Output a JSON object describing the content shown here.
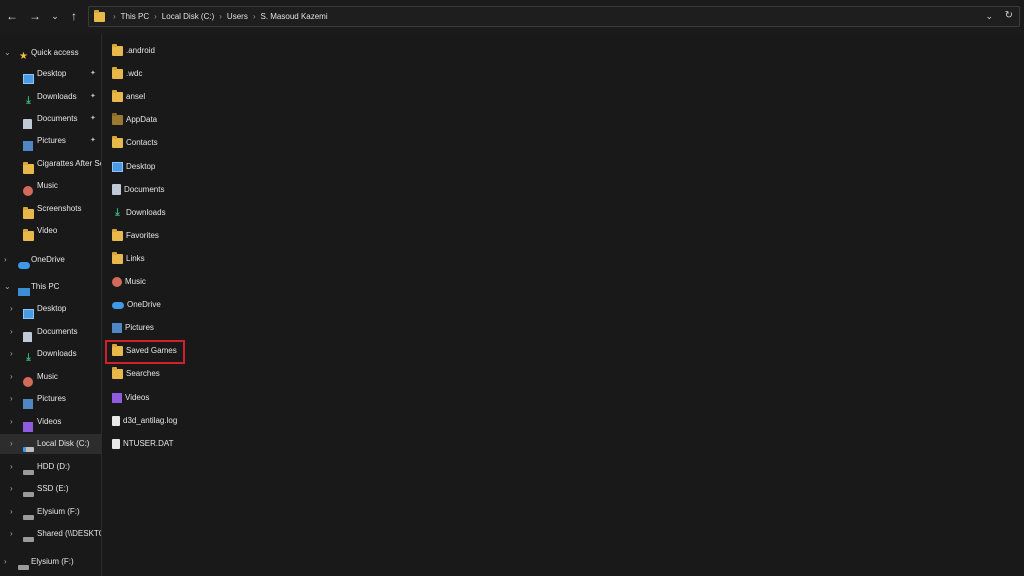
{
  "toolbar": {
    "back": "←",
    "forward": "→",
    "recent": "⌄",
    "up": "↑"
  },
  "address": {
    "crumbs": [
      "This PC",
      "Local Disk (C:)",
      "Users",
      "S. Masoud Kazemi"
    ],
    "separator": "›",
    "dropdown": "⌄",
    "refresh": "↻"
  },
  "sidebar": {
    "items": [
      {
        "label": "Quick access",
        "icon": "star-icon",
        "chevron": "⌄"
      },
      {
        "label": "Desktop",
        "icon": "desktop-icon",
        "pin": "📌"
      },
      {
        "label": "Downloads",
        "icon": "downloads-icon",
        "pin": "📌"
      },
      {
        "label": "Documents",
        "icon": "documents-icon",
        "pin": "📌"
      },
      {
        "label": "Pictures",
        "icon": "pictures-icon",
        "pin": "📌"
      },
      {
        "label": "Cigarattes After Se",
        "icon": "folder-icon"
      },
      {
        "label": "Music",
        "icon": "music-icon"
      },
      {
        "label": "Screenshots",
        "icon": "folder-icon"
      },
      {
        "label": "Video",
        "icon": "folder-icon"
      },
      {
        "label": "OneDrive",
        "icon": "onedrive-icon",
        "chevron": "›"
      },
      {
        "label": "This PC",
        "icon": "this-pc-icon",
        "chevron": "⌄"
      },
      {
        "label": "Desktop",
        "icon": "desktop-icon",
        "chevron": "›"
      },
      {
        "label": "Documents",
        "icon": "documents-icon",
        "chevron": "›"
      },
      {
        "label": "Downloads",
        "icon": "downloads-icon",
        "chevron": "›"
      },
      {
        "label": "Music",
        "icon": "music-icon",
        "chevron": "›"
      },
      {
        "label": "Pictures",
        "icon": "pictures-icon",
        "chevron": "›"
      },
      {
        "label": "Videos",
        "icon": "videos-icon",
        "chevron": "›"
      },
      {
        "label": "Local Disk (C:)",
        "icon": "windows-drive-icon",
        "chevron": "›",
        "selected": true
      },
      {
        "label": "HDD (D:)",
        "icon": "drive-icon",
        "chevron": "›"
      },
      {
        "label": "SSD (E:)",
        "icon": "drive-icon",
        "chevron": "›"
      },
      {
        "label": "Elysium (F:)",
        "icon": "drive-icon",
        "chevron": "›"
      },
      {
        "label": "Shared (\\\\DESKTOI",
        "icon": "network-drive-icon",
        "chevron": "›"
      },
      {
        "label": "Elysium (F:)",
        "icon": "drive-icon",
        "chevron": "›"
      }
    ]
  },
  "files": [
    {
      "label": ".android",
      "icon": "folder-icon"
    },
    {
      "label": ".wdc",
      "icon": "folder-icon"
    },
    {
      "label": "ansel",
      "icon": "folder-icon"
    },
    {
      "label": "AppData",
      "icon": "folder-hidden-icon"
    },
    {
      "label": "Contacts",
      "icon": "folder-icon"
    },
    {
      "label": "Desktop",
      "icon": "desktop-icon"
    },
    {
      "label": "Documents",
      "icon": "documents-icon"
    },
    {
      "label": "Downloads",
      "icon": "downloads-icon"
    },
    {
      "label": "Favorites",
      "icon": "folder-icon"
    },
    {
      "label": "Links",
      "icon": "folder-icon"
    },
    {
      "label": "Music",
      "icon": "music-icon"
    },
    {
      "label": "OneDrive",
      "icon": "onedrive-icon"
    },
    {
      "label": "Pictures",
      "icon": "pictures-icon"
    },
    {
      "label": "Saved Games",
      "icon": "folder-icon",
      "highlighted": true
    },
    {
      "label": "Searches",
      "icon": "folder-icon"
    },
    {
      "label": "Videos",
      "icon": "videos-icon"
    },
    {
      "label": "d3d_antilag.log",
      "icon": "file-icon"
    },
    {
      "label": "NTUSER.DAT",
      "icon": "file-icon"
    }
  ],
  "colors": {
    "highlight": "#d0202a",
    "folder": "#e8b84a",
    "background": "#191919"
  }
}
